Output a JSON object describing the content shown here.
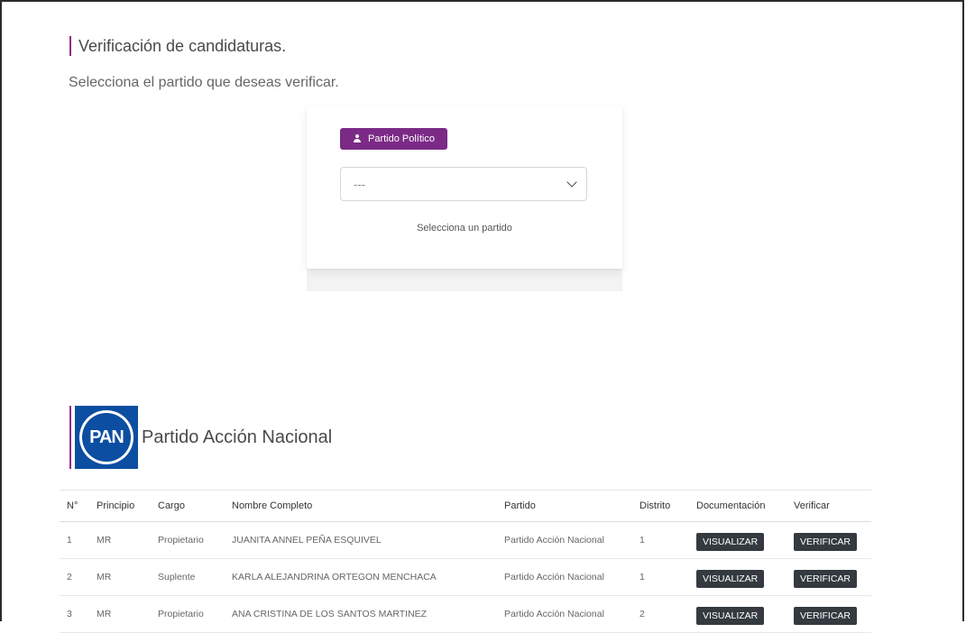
{
  "header": {
    "title": "Verificación de candidaturas.",
    "subtitle": "Selecciona el partido que deseas verificar."
  },
  "selector": {
    "button_label": "Partido Político",
    "button_icon": "user-icon",
    "select_value": "---",
    "help_text": "Selecciona un partido"
  },
  "party": {
    "logo_text": "PAN",
    "name": "Partido Acción Nacional"
  },
  "table": {
    "columns": [
      "N°",
      "Principio",
      "Cargo",
      "Nombre Completo",
      "Partido",
      "Distrito",
      "Documentación",
      "Verificar"
    ],
    "view_label": "VISUALIZAR",
    "verify_label": "VERIFICAR",
    "rows": [
      {
        "n": "1",
        "principio": "MR",
        "cargo": "Propietario",
        "nombre": "JUANITA ANNEL PEÑA ESQUIVEL",
        "partido": "Partido Acción Nacional",
        "distrito": "1"
      },
      {
        "n": "2",
        "principio": "MR",
        "cargo": "Suplente",
        "nombre": "KARLA ALEJANDRINA ORTEGON MENCHACA",
        "partido": "Partido Acción Nacional",
        "distrito": "1"
      },
      {
        "n": "3",
        "principio": "MR",
        "cargo": "Propietario",
        "nombre": "ANA CRISTINA DE LOS SANTOS MARTINEZ",
        "partido": "Partido Acción Nacional",
        "distrito": "2"
      }
    ]
  },
  "colors": {
    "accent": "#7b2a86",
    "pan_blue": "#0b4ea2",
    "button_dark": "#343a40"
  }
}
